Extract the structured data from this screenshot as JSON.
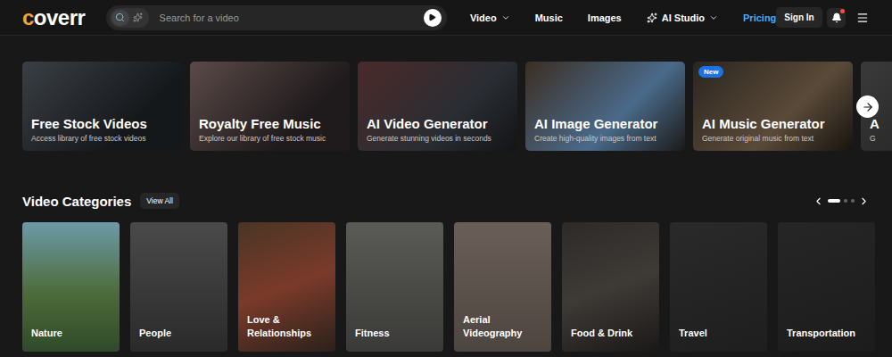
{
  "header": {
    "logo": "coverr",
    "search": {
      "placeholder": "Search for a video",
      "modes": [
        {
          "kind": "search",
          "selected": true
        },
        {
          "kind": "ai",
          "selected": false
        }
      ]
    },
    "nav": [
      {
        "label": "Video",
        "kind": "plain",
        "dropdown": true,
        "highlighted": false
      },
      {
        "label": "Music",
        "kind": "plain",
        "dropdown": false,
        "highlighted": false
      },
      {
        "label": "Images",
        "kind": "plain",
        "dropdown": false,
        "highlighted": false
      },
      {
        "label": "AI Studio",
        "kind": "ai",
        "dropdown": true,
        "highlighted": false
      },
      {
        "label": "Pricing",
        "kind": "plain",
        "dropdown": false,
        "highlighted": true
      }
    ],
    "sign_in": "Sign In",
    "notifications": {
      "unread": true
    }
  },
  "features": {
    "cards": [
      {
        "title": "Free Stock Videos",
        "subtitle": "Access library of free stock videos",
        "badge": ""
      },
      {
        "title": "Royalty Free Music",
        "subtitle": "Explore our library of free stock music",
        "badge": ""
      },
      {
        "title": "AI Video Generator",
        "subtitle": "Generate stunning videos in seconds",
        "badge": ""
      },
      {
        "title": "AI Image Generator",
        "subtitle": "Create high-quality images from text",
        "badge": ""
      },
      {
        "title": "AI Music Generator",
        "subtitle": "Generate original music from text",
        "badge": "New"
      },
      {
        "title": "A",
        "subtitle": "G",
        "badge": ""
      }
    ]
  },
  "categories": {
    "title": "Video Categories",
    "view_all": "View All",
    "pages": [
      {
        "selected": true
      },
      {
        "selected": false
      },
      {
        "selected": false
      }
    ],
    "items": [
      {
        "label": "Nature"
      },
      {
        "label": "People"
      },
      {
        "label": "Love & Relationships"
      },
      {
        "label": "Fitness"
      },
      {
        "label": "Aerial Videography"
      },
      {
        "label": "Food & Drink"
      },
      {
        "label": "Travel"
      },
      {
        "label": "Transportation"
      }
    ]
  }
}
